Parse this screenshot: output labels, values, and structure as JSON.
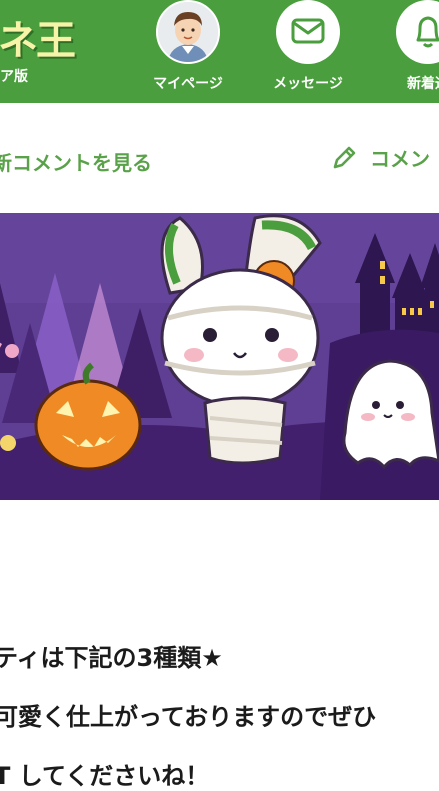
{
  "header": {
    "logo_text": "ネ王",
    "logo_sub": "ア版",
    "nav": [
      {
        "label": "マイページ",
        "icon": "avatar"
      },
      {
        "label": "メッセージ",
        "icon": "envelope-icon"
      },
      {
        "label": "新着通",
        "icon": "bell-icon"
      }
    ]
  },
  "comments": {
    "latest_label": "新コメントを見る",
    "write_label": "コメン"
  },
  "banner": {
    "theme": "halloween",
    "colors": {
      "sky": "#5e3f93",
      "ground": "#43206e",
      "pumpkin": "#f08a24",
      "accent": "#4a9e3d"
    }
  },
  "article": {
    "lines": [
      "ティは下記の3種類★",
      "可愛く仕上がっておりますのでぜひ",
      "T してくださいね！"
    ]
  },
  "colors": {
    "header_green": "#4a9e3d",
    "text_green": "#5aa24a",
    "text_dark": "#1b1b1b"
  }
}
